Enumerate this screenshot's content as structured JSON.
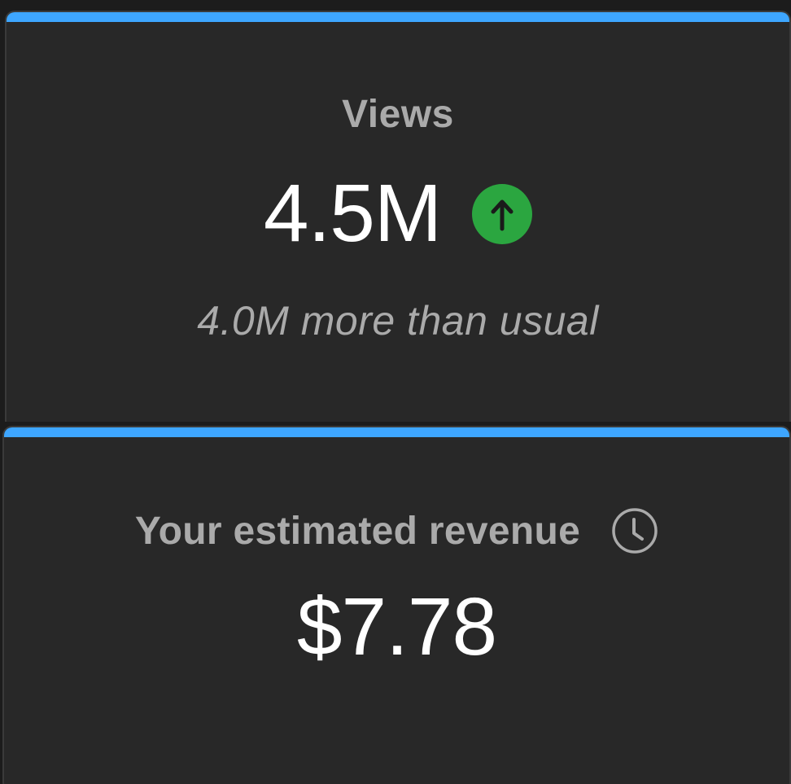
{
  "views_card": {
    "label": "Views",
    "value": "4.5M",
    "trend_icon": "arrow-up-icon",
    "trend_color": "#2ba640",
    "comparison": "4.0M more than usual"
  },
  "revenue_card": {
    "label": "Your estimated revenue",
    "info_icon": "clock-icon",
    "value": "$7.78"
  },
  "colors": {
    "accent": "#3ea6ff",
    "card_background": "#282828",
    "label_text": "#aaaaaa",
    "value_text": "#ffffff"
  }
}
